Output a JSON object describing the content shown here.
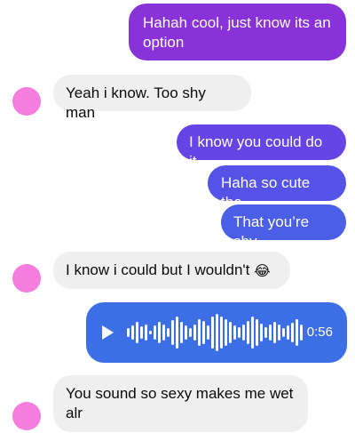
{
  "messages": [
    {
      "text": "Hahah cool, just know its an option"
    },
    {
      "text": "Yeah i know. Too shy man"
    },
    {
      "text": "I know you could do it"
    },
    {
      "text": "Haha so cute tho"
    },
    {
      "text": "That you’re shy"
    },
    {
      "text": "I know i could but I wouldn't",
      "emoji": "😂"
    },
    {
      "text": "You sound so sexy makes me wet alr"
    }
  ],
  "voice_message": {
    "duration": "0:56",
    "play_icon": "play-icon",
    "waveform_icon": "waveform-icon"
  },
  "colors": {
    "outgoing_purple": "#8a32d9",
    "outgoing_indigo": "#6644e6",
    "outgoing_blue": "#4a5ee8",
    "voice_blue": "#3c6ee5",
    "incoming_gray": "#efeff0",
    "avatar_pink": "#f47ddd"
  }
}
